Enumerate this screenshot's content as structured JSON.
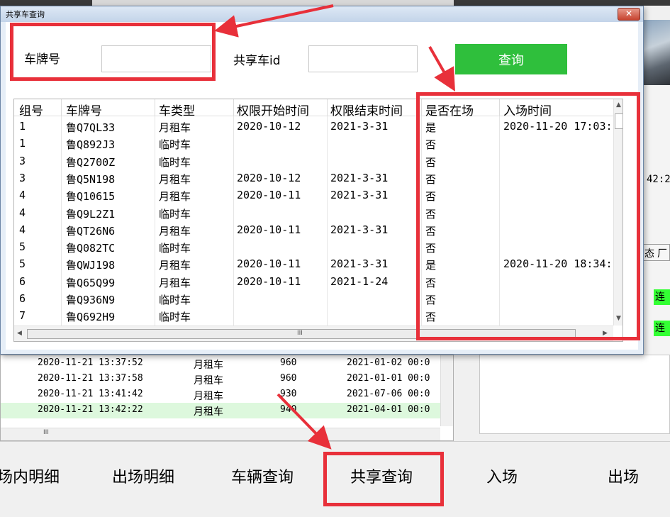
{
  "background": {
    "right_time_partial": "42:2",
    "right_tab_partial_1": "态",
    "right_tab_partial_2": "厂",
    "right_green_label": "连",
    "list_rows": [
      {
        "time": "2020-11-21 13:37:52",
        "type": "月租车",
        "amount": "960",
        "expire": "2021-01-02 00:0"
      },
      {
        "time": "2020-11-21 13:37:58",
        "type": "月租车",
        "amount": "960",
        "expire": "2021-01-01 00:0"
      },
      {
        "time": "2020-11-21 13:41:42",
        "type": "月租车",
        "amount": "930",
        "expire": "2021-07-06 00:0"
      },
      {
        "time": "2020-11-21 13:42:22",
        "type": "月租车",
        "amount": "940",
        "expire": "2021-04-01 00:0"
      }
    ],
    "scroll_mark": "III"
  },
  "bottom_nav": {
    "items": [
      "场内明细",
      "出场明细",
      "车辆查询",
      "共享查询",
      "入场",
      "出场"
    ]
  },
  "dialog": {
    "title": "共享车查询",
    "close_label": "✕",
    "plate_label": "车牌号",
    "plate_value": "",
    "shareid_label": "共享车id",
    "shareid_value": "",
    "query_label": "查询",
    "columns": [
      "组号",
      "车牌号",
      "车类型",
      "权限开始时间",
      "权限结束时间",
      "是否在场",
      "入场时间"
    ],
    "rows": [
      [
        "1",
        "鲁Q7QL33",
        "月租车",
        "2020-10-12",
        "2021-3-31",
        "是",
        "2020-11-20 17:03:"
      ],
      [
        "1",
        "鲁Q892J3",
        "临时车",
        "",
        "",
        "否",
        ""
      ],
      [
        "3",
        "鲁Q2700Z",
        "临时车",
        "",
        "",
        "否",
        ""
      ],
      [
        "3",
        "鲁Q5N198",
        "月租车",
        "2020-10-12",
        "2021-3-31",
        "否",
        ""
      ],
      [
        "4",
        "鲁Q10615",
        "月租车",
        "2020-10-11",
        "2021-3-31",
        "否",
        ""
      ],
      [
        "4",
        "鲁Q9L2Z1",
        "临时车",
        "",
        "",
        "否",
        ""
      ],
      [
        "4",
        "鲁QT26N6",
        "月租车",
        "2020-10-11",
        "2021-3-31",
        "否",
        ""
      ],
      [
        "5",
        "鲁Q082TC",
        "临时车",
        "",
        "",
        "否",
        ""
      ],
      [
        "5",
        "鲁QWJ198",
        "月租车",
        "2020-10-11",
        "2021-3-31",
        "是",
        "2020-11-20 18:34:"
      ],
      [
        "6",
        "鲁Q65Q99",
        "月租车",
        "2020-10-11",
        "2021-1-24",
        "否",
        ""
      ],
      [
        "6",
        "鲁Q936N9",
        "临时车",
        "",
        "",
        "否",
        ""
      ],
      [
        "7",
        "鲁Q692H9",
        "临时车",
        "",
        "",
        "否",
        ""
      ]
    ],
    "scroll_mark": "III"
  },
  "colors": {
    "annotation_red": "#e8303a",
    "query_button": "#2fbf3c",
    "highlight_row": "#ddf8dd"
  }
}
